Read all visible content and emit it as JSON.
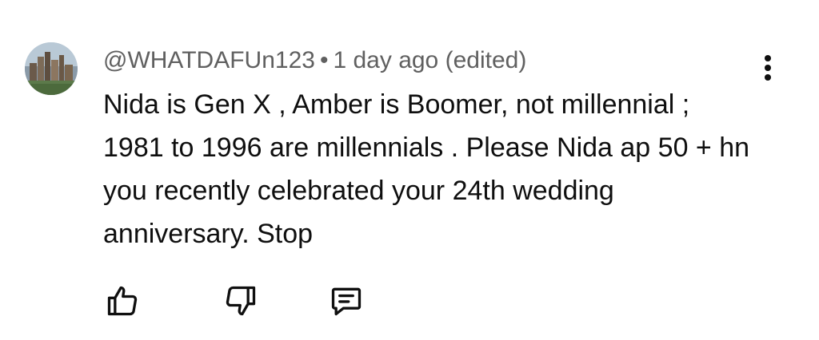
{
  "comment": {
    "author": "@WHATDAFUn123",
    "separator": "•",
    "timestamp": "1 day ago",
    "edited": "(edited)",
    "text": "Nida is Gen X , Amber is Boomer, not millennial ; 1981 to 1996 are millennials . Please Nida ap 50 + hn you recently celebrated your 24th wedding anniversary. Stop"
  },
  "icons": {
    "avatar": "city-skyline-avatar",
    "menu": "more-vertical-icon",
    "like": "thumbs-up-icon",
    "dislike": "thumbs-down-icon",
    "reply": "comment-reply-icon"
  },
  "colors": {
    "text_primary": "#0f0f0f",
    "text_secondary": "#606060",
    "background": "#ffffff"
  }
}
